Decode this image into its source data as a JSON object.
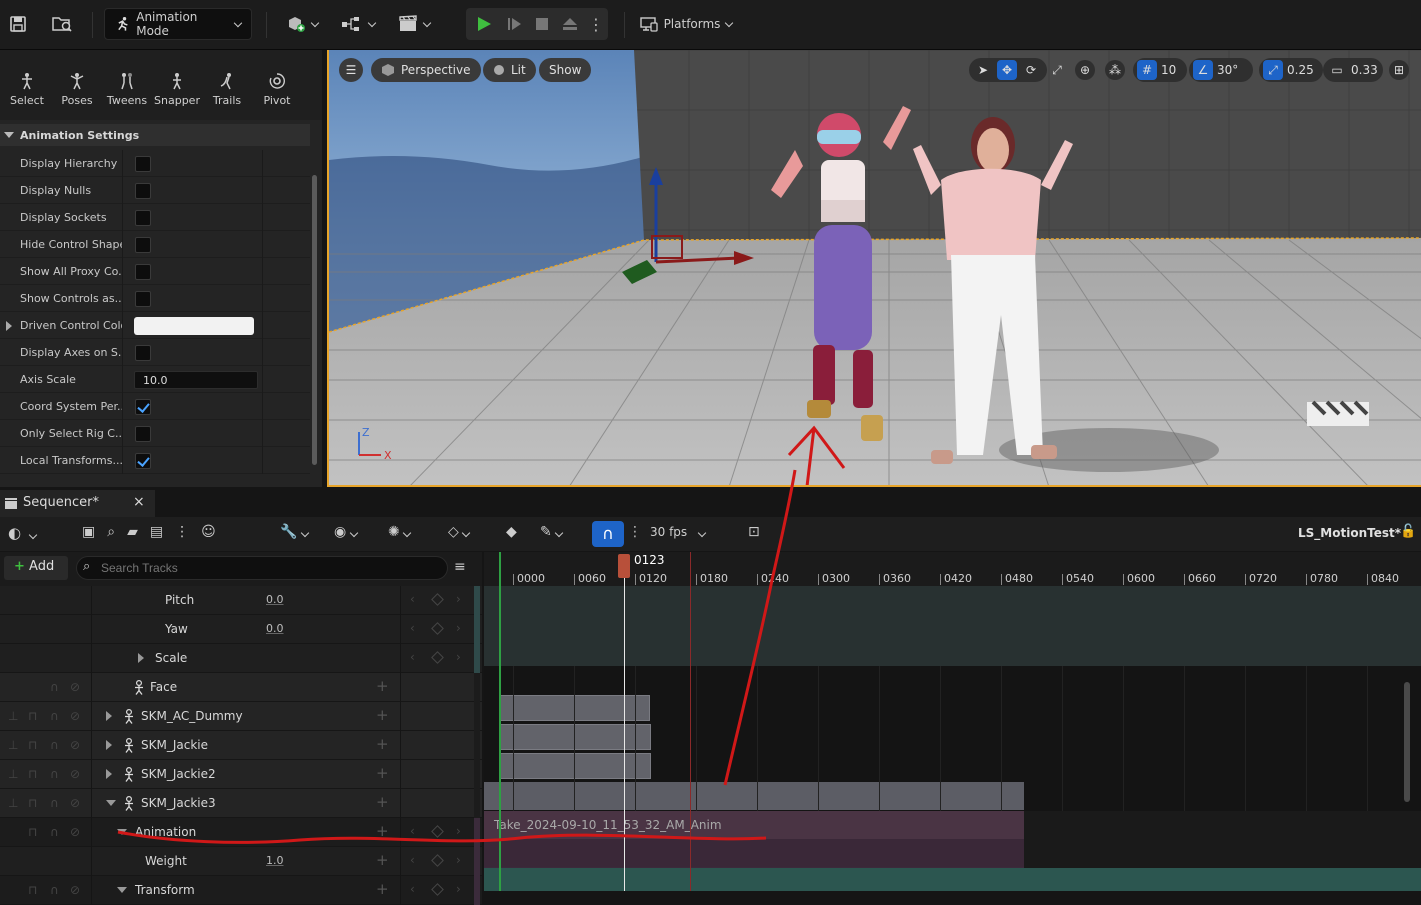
{
  "toolbar": {
    "mode_label": "Animation Mode",
    "platforms_label": "Platforms",
    "icons": [
      "save-icon",
      "browse-icon",
      "add-actor-icon",
      "blueprint-icon",
      "cinematics-icon",
      "play-icon",
      "advance-frame-icon",
      "stop-icon",
      "eject-icon",
      "more-icon",
      "platforms-icon"
    ]
  },
  "modes": [
    "Select",
    "Poses",
    "Tweens",
    "Snapper",
    "Trails",
    "Pivot"
  ],
  "animation_settings": {
    "header": "Animation Settings",
    "rows": [
      {
        "label": "Display Hierarchy",
        "type": "checkbox",
        "checked": false
      },
      {
        "label": "Display Nulls",
        "type": "checkbox",
        "checked": false
      },
      {
        "label": "Display Sockets",
        "type": "checkbox",
        "checked": false
      },
      {
        "label": "Hide Control Shapes",
        "type": "checkbox",
        "checked": false
      },
      {
        "label": "Show All Proxy Co...",
        "type": "checkbox",
        "checked": false
      },
      {
        "label": "Show Controls as...",
        "type": "checkbox",
        "checked": false
      },
      {
        "label": "Driven Control Color",
        "type": "color",
        "value": "#f2f2f2"
      },
      {
        "label": "Display Axes on S...",
        "type": "checkbox",
        "checked": false
      },
      {
        "label": "Axis Scale",
        "type": "value",
        "value": "10.0"
      },
      {
        "label": "Coord System Per...",
        "type": "checkbox",
        "checked": true
      },
      {
        "label": "Only Select Rig C...",
        "type": "checkbox",
        "checked": false
      },
      {
        "label": "Local Transforms...",
        "type": "checkbox",
        "checked": true
      }
    ]
  },
  "viewport": {
    "perspective_label": "Perspective",
    "lit_label": "Lit",
    "show_label": "Show",
    "grid_snap": "10",
    "rotation_snap": "30°",
    "scale_snap": "0.25",
    "camera_speed": "0.33"
  },
  "sequencer": {
    "tab_label": "Sequencer*",
    "close_label": "×",
    "fps_label": "30 fps",
    "sequence_name": "LS_MotionTest*",
    "add_label": "Add",
    "search_placeholder": "Search Tracks",
    "playhead_frame": "0123",
    "ticks": [
      "0000",
      "0060",
      "0120",
      "0180",
      "0240",
      "0300",
      "0360",
      "0420",
      "0480",
      "0540",
      "0600",
      "0660",
      "0720",
      "0780",
      "0840"
    ],
    "tracks": [
      {
        "label": "Pitch",
        "value": "0.0"
      },
      {
        "label": "Yaw",
        "value": "0.0"
      },
      {
        "label": "Scale"
      },
      {
        "label": "Face"
      },
      {
        "label": "SKM_AC_Dummy"
      },
      {
        "label": "SKM_Jackie"
      },
      {
        "label": "SKM_Jackie2"
      },
      {
        "label": "SKM_Jackie3"
      },
      {
        "label": "Animation"
      },
      {
        "label": "Weight",
        "value": "1.0"
      },
      {
        "label": "Transform"
      }
    ],
    "anim_clip_label": "Take_2024-09-10_11_53_32_AM_Anim"
  },
  "colors": {
    "accent": "#1e64c8",
    "play_green": "#3fbf3f",
    "viewport_border": "#e8a52a",
    "annotation_red": "#d01818"
  }
}
